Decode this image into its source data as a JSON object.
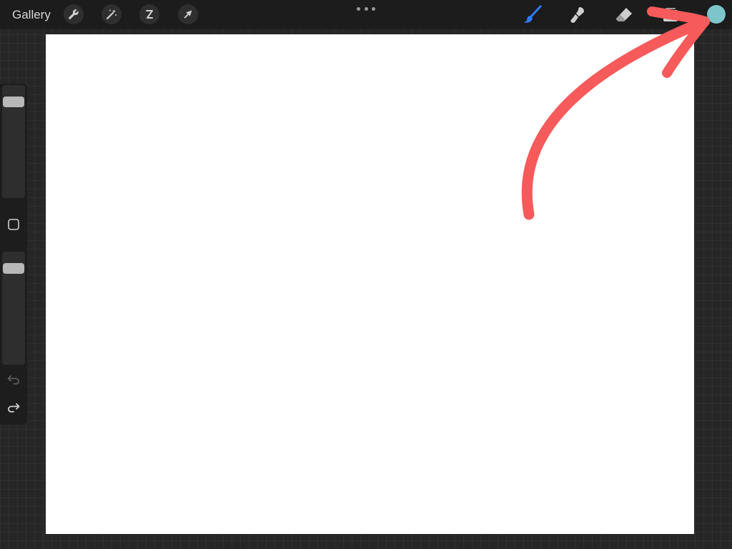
{
  "toolbar": {
    "gallery_label": "Gallery",
    "left_tools": [
      {
        "name": "actions",
        "icon": "wrench-icon"
      },
      {
        "name": "adjustments",
        "icon": "magic-wand-icon"
      },
      {
        "name": "selection",
        "icon": "selection-s-icon"
      },
      {
        "name": "transform",
        "icon": "arrow-cursor-icon"
      }
    ],
    "right_tools": [
      {
        "name": "brush",
        "icon": "brush-icon",
        "active": true
      },
      {
        "name": "smudge",
        "icon": "smudge-icon",
        "active": false
      },
      {
        "name": "eraser",
        "icon": "eraser-icon",
        "active": false
      },
      {
        "name": "layers",
        "icon": "layers-icon",
        "active": false
      }
    ],
    "current_color": "#7dc4cb"
  },
  "sidebar": {
    "brush_size_level": 0.1,
    "opacity_level": 0.1
  },
  "colors": {
    "active_tool": "#2e7bff",
    "annotation": "#f75a5a",
    "canvas": "#ffffff"
  }
}
